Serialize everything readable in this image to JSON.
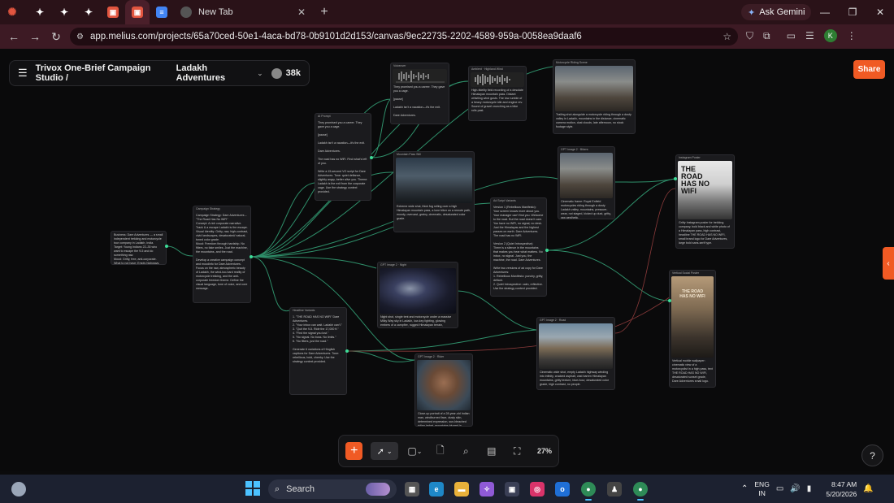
{
  "browser": {
    "tabs": [
      {
        "favicon": "asterisk-icon",
        "color": "#e2553f"
      },
      {
        "favicon": "diamond-icon",
        "color": "#ffffff"
      },
      {
        "favicon": "diamond-icon",
        "color": "#ffffff"
      },
      {
        "favicon": "diamond-icon",
        "color": "#ffffff"
      },
      {
        "favicon": "square-logo-icon",
        "color": "#e2553f"
      },
      {
        "favicon": "square-logo-icon",
        "color": "#e2553f",
        "active": true
      },
      {
        "favicon": "docs-icon",
        "color": "#4285f4"
      }
    ],
    "main_tab_title": "New Tab",
    "ask_gemini_label": "Ask Gemini",
    "url": "app.melius.com/projects/65a70ced-50e1-4aca-bd78-0b9101d2d153/canvas/9ec22735-2202-4589-959a-0058ea9daaf6",
    "profile_initial": "K"
  },
  "app": {
    "project_name": "Trivox One-Brief Campaign Studio /",
    "canvas_name": "Ladakh Adventures",
    "credits": "38k",
    "share_label": "Share",
    "zoom": "27%",
    "accent": "#f05a24",
    "wire_color": "#2f8f6a"
  },
  "nodes": {
    "brief": {
      "text": "Business: Dare Adventures — a small independent trekking and motorcycle tour company in Ladakh, India.\nTarget: Young Indians 22–35 who want to escape the 9-5 and do something raw.\nMood: Gritty, free, anti-corporate. What to not have: Empty highways, No Wires.\nCampaign Headline: \"The Road has No WiFi\""
    },
    "strategy": {
      "head": "Campaign Strategy",
      "text": "Campaign Strategy: Dare Adventures – \"The Road Has No WiFi\"\nConcept: A rich corporate narrative. Track & a escape Ladakh is the escape.\nVisual Identity: Gritty, raw, high-contrast, vivid landscapes, desaturated/ natural-toned color grade.\nMood: Freedom through hardship. No filters, no fake smiles. Just the machine, the mountains, and the road.\n\nDevelop a creative campaign concept and moodinfo for Dare Adventures. Focus on the raw, atmospheric beauty of Ladakh, the wind-too-hard reality of motorcycle trekking, and the anti-corporate freedom theme. Define the visual language, tone of voice, and core message."
    },
    "prompt_top": {
      "head": "AI Prompt",
      "text": "They promised you a career. They gave you a cage.\n\n[pause]\n\nLadakh isn't a vacation—it's the exit.\n\nDare Adventures.\n\nThe road has no WiFi. Find what's left of you.\n\nWrite a 15-second VO script for Dare Adventures. Tone: quiet defiance, slightly angry, better alive you. Theme: Ladakh is the exit from the corporate cage. Use the strategy context provided."
    },
    "audio1": {
      "head": "Voiceover",
      "text": "They promised you a career. They gave you a cage.\n\n[pause]\n\nLadakh isn't a vacation—it's the exit.\n\nDare Adventures."
    },
    "audio2": {
      "head": "Ambient · Highland Wind",
      "text": "High-fidelity field recording of a desolate Himalayan mountain pass. Distant whistling wind gusts. The low rumble of a heavy motorcycle idle and engine rev. Sound of gravel crunching as a bike rolls past."
    },
    "img_top": {
      "head": "Motorcycle Riding Scene",
      "text": "Trailing shot alongside a motorcycle riding through a dusty valley in Ladakh, mountains in the distance, cinematic camera motion, dust clouds, late afternoon, no stock footage style."
    },
    "storm": {
      "head": "Mountain Pass Still",
      "text": "Extreme wide shot, thick fog rolling over a high Himalayan mountain pass, a lone biker on a remote path, moody, overcast, grainy, cinematic, desaturated color grade."
    },
    "bikes": {
      "head": "GPT Image 2 · Bikers",
      "text": "Cinematic frame: Royal Enfield motorcycles riding through a dusty Ladakh valley, mountains, pressure-wear, not staged, kicked up dust, gritty, raw aesthetic."
    },
    "poster_top": {
      "head": "Instagram Poster",
      "text": "Gritty Instagram poster for trekking company, bold black and white photo of a Himalayan pass, high contrast, headline THE ROAD HAS NO WIFI, small brand logo for Dare Adventures, large bold sans-serif type."
    },
    "script": {
      "head": "Ad Script Variants",
      "text": "Version 1 (Rebellious Manifesto):\nYour screen knows more about you. Your manager can't find you. Welcome to the road. But the road doesn't care. You have no WiFi, no signal, no desk. Just the Himalayas and the highest passes on earth. Dare Adventures. The road has no WiFi.\n\nVersion 2 (Quiet Introspective):\nThere is a silence in the mountains that makes you hear what matters. No inbox, no signal. Just you, the machine, the road. Dare Adventures.\n\nWrite two versions of ad copy for Dare Adventures:\n1. Rebellious Manifesto: punchy, gritty, defiant.\n2. Quiet Introspective: calm, reflective.\nUse the strategy context provided."
    },
    "night": {
      "head": "GPT Image 2 · Night",
      "text": "Night shot, single tent and motorcycle under a massive Milky Way sky in Ladakh, low-key lighting, glowing embers of a campfire, rugged Himalayan terrain, cinematic atmosphere."
    },
    "poster_bottom": {
      "head": "Vertical Social Poster",
      "text": "Vertical mobile wallpaper: cinematic view of a motorcyclist in a high pass, text THE ROAD HAS NO WIFI, desaturated sunset grade, Dare Adventures small logo."
    },
    "headline": {
      "head": "Headline Variants",
      "text": "1. \"THE ROAD HAS NO WIFI\" Dare Adventures.\n2. \"Your inbox can wait. Ladakh can't.\"\n3. \"Quit the 9-5. Ride the 17,000 ft.\"\n4. \"Find the signal you lost.\"\n5. \"No signal. No boss. No limits.\"\n6. \"No filters, just the road.\"\n\nGenerate 6 variations of Hinglish captions for Dare Adventures. Tone: rebellious, bold, cheeky. Use the strategy context provided."
    },
    "road": {
      "head": "GPT Image 2 · Road",
      "text": "Cinematic wide shot, empty Ladakh highway winding into infinity, cracked asphalt, vast barren Himalayan mountains, gritty texture, blue-hour, desaturated color grade, high contrast, no people."
    },
    "face": {
      "head": "GPT Image 2 · Rider",
      "text": "Close-up portrait of a 28-year-old Indian man, windburned face, dusty skin, determined expression, sun-bleached riding jacket, mountains blurred in background, raw grit, natural lighting, desaturated tones."
    }
  },
  "toolbar": {
    "add": "+",
    "select": "pointer-icon"
  },
  "taskbar": {
    "search_label": "Search",
    "lang_top": "ENG",
    "lang_bottom": "IN",
    "time": "8:47 AM",
    "date": "5/20/2026"
  }
}
